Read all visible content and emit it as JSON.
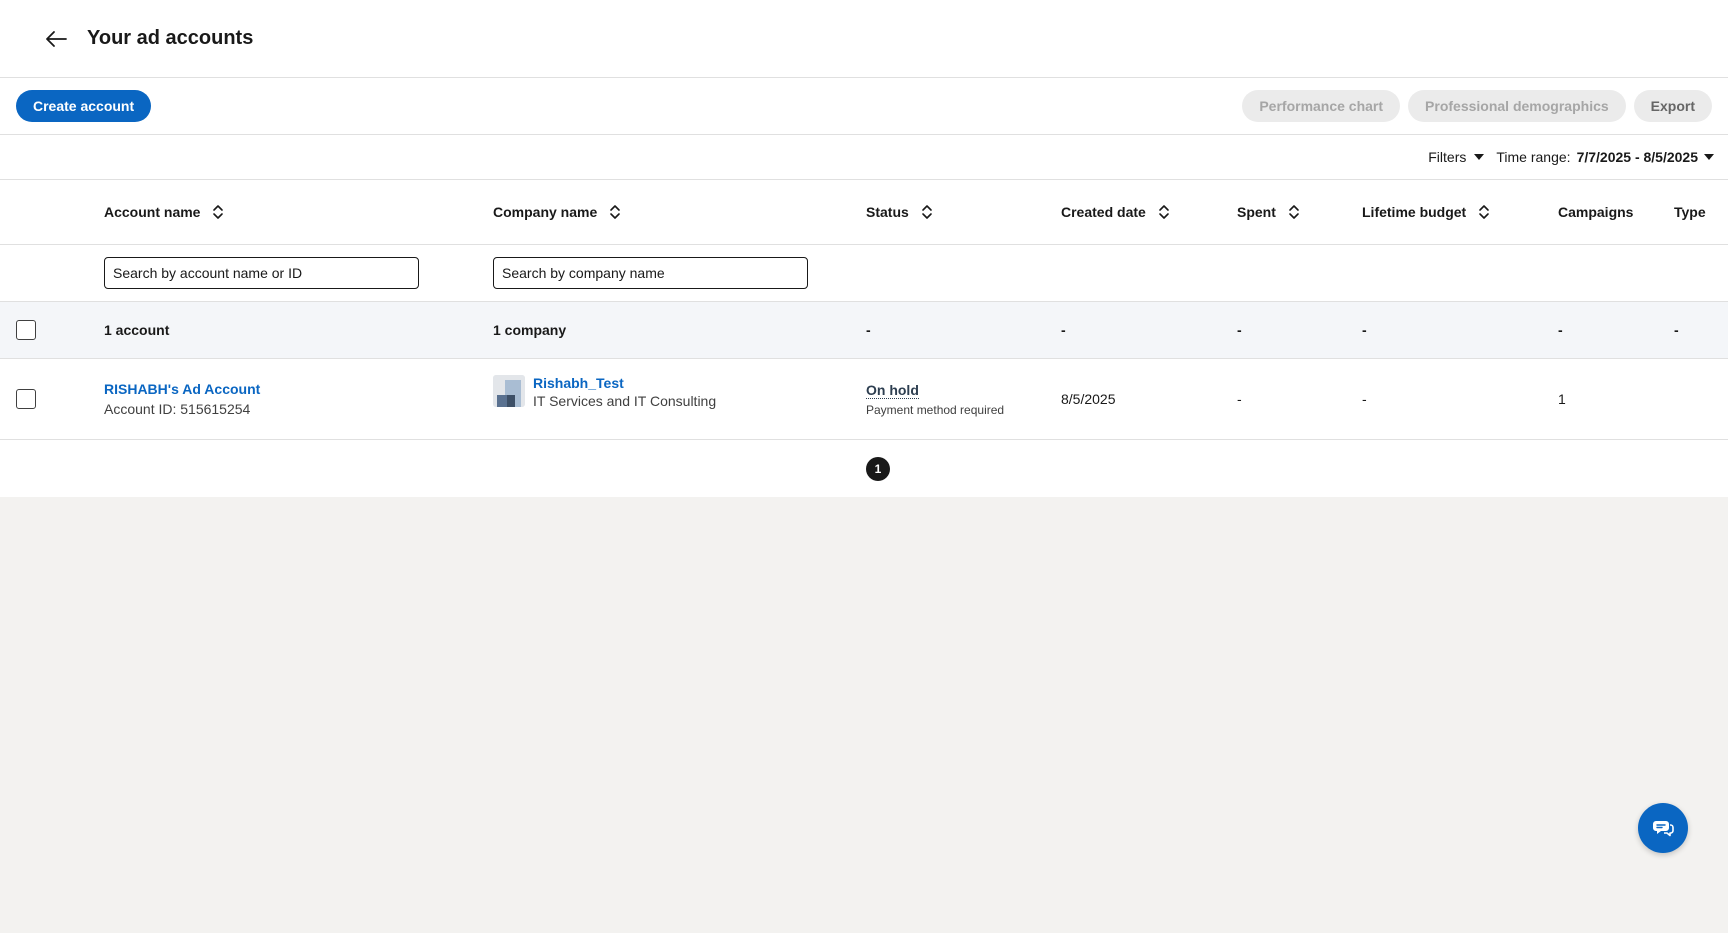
{
  "header": {
    "title": "Your ad accounts"
  },
  "toolbar": {
    "create_label": "Create account",
    "performance_chart_label": "Performance chart",
    "demographics_label": "Professional demographics",
    "export_label": "Export"
  },
  "filterbar": {
    "filters_label": "Filters",
    "time_range_label": "Time range:",
    "time_range_value": "7/7/2025 - 8/5/2025"
  },
  "table": {
    "columns": {
      "account_name": "Account name",
      "company_name": "Company name",
      "status": "Status",
      "created_date": "Created date",
      "spent": "Spent",
      "lifetime_budget": "Lifetime budget",
      "campaigns": "Campaigns",
      "type": "Type"
    },
    "search": {
      "account_placeholder": "Search by account name or ID",
      "company_placeholder": "Search by company name"
    },
    "summary": {
      "accounts": "1 account",
      "companies": "1 company",
      "status": "-",
      "created_date": "-",
      "spent": "-",
      "lifetime_budget": "-",
      "campaigns": "-",
      "type": "-"
    },
    "rows": [
      {
        "account_name": "RISHABH's Ad Account",
        "account_id": "Account ID: 515615254",
        "company_name": "Rishabh_Test",
        "company_industry": "IT Services and IT Consulting",
        "status": "On hold",
        "status_detail": "Payment method required",
        "created_date": "8/5/2025",
        "spent": "-",
        "lifetime_budget": "-",
        "campaigns": "1",
        "type": ""
      }
    ]
  },
  "pagination": {
    "current_page": "1"
  },
  "colors": {
    "accent": "#0a66c2",
    "background": "#f3f2f0"
  },
  "icons": {
    "back": "arrow-left-icon",
    "sort": "sort-icon",
    "chat": "chat-icon"
  }
}
